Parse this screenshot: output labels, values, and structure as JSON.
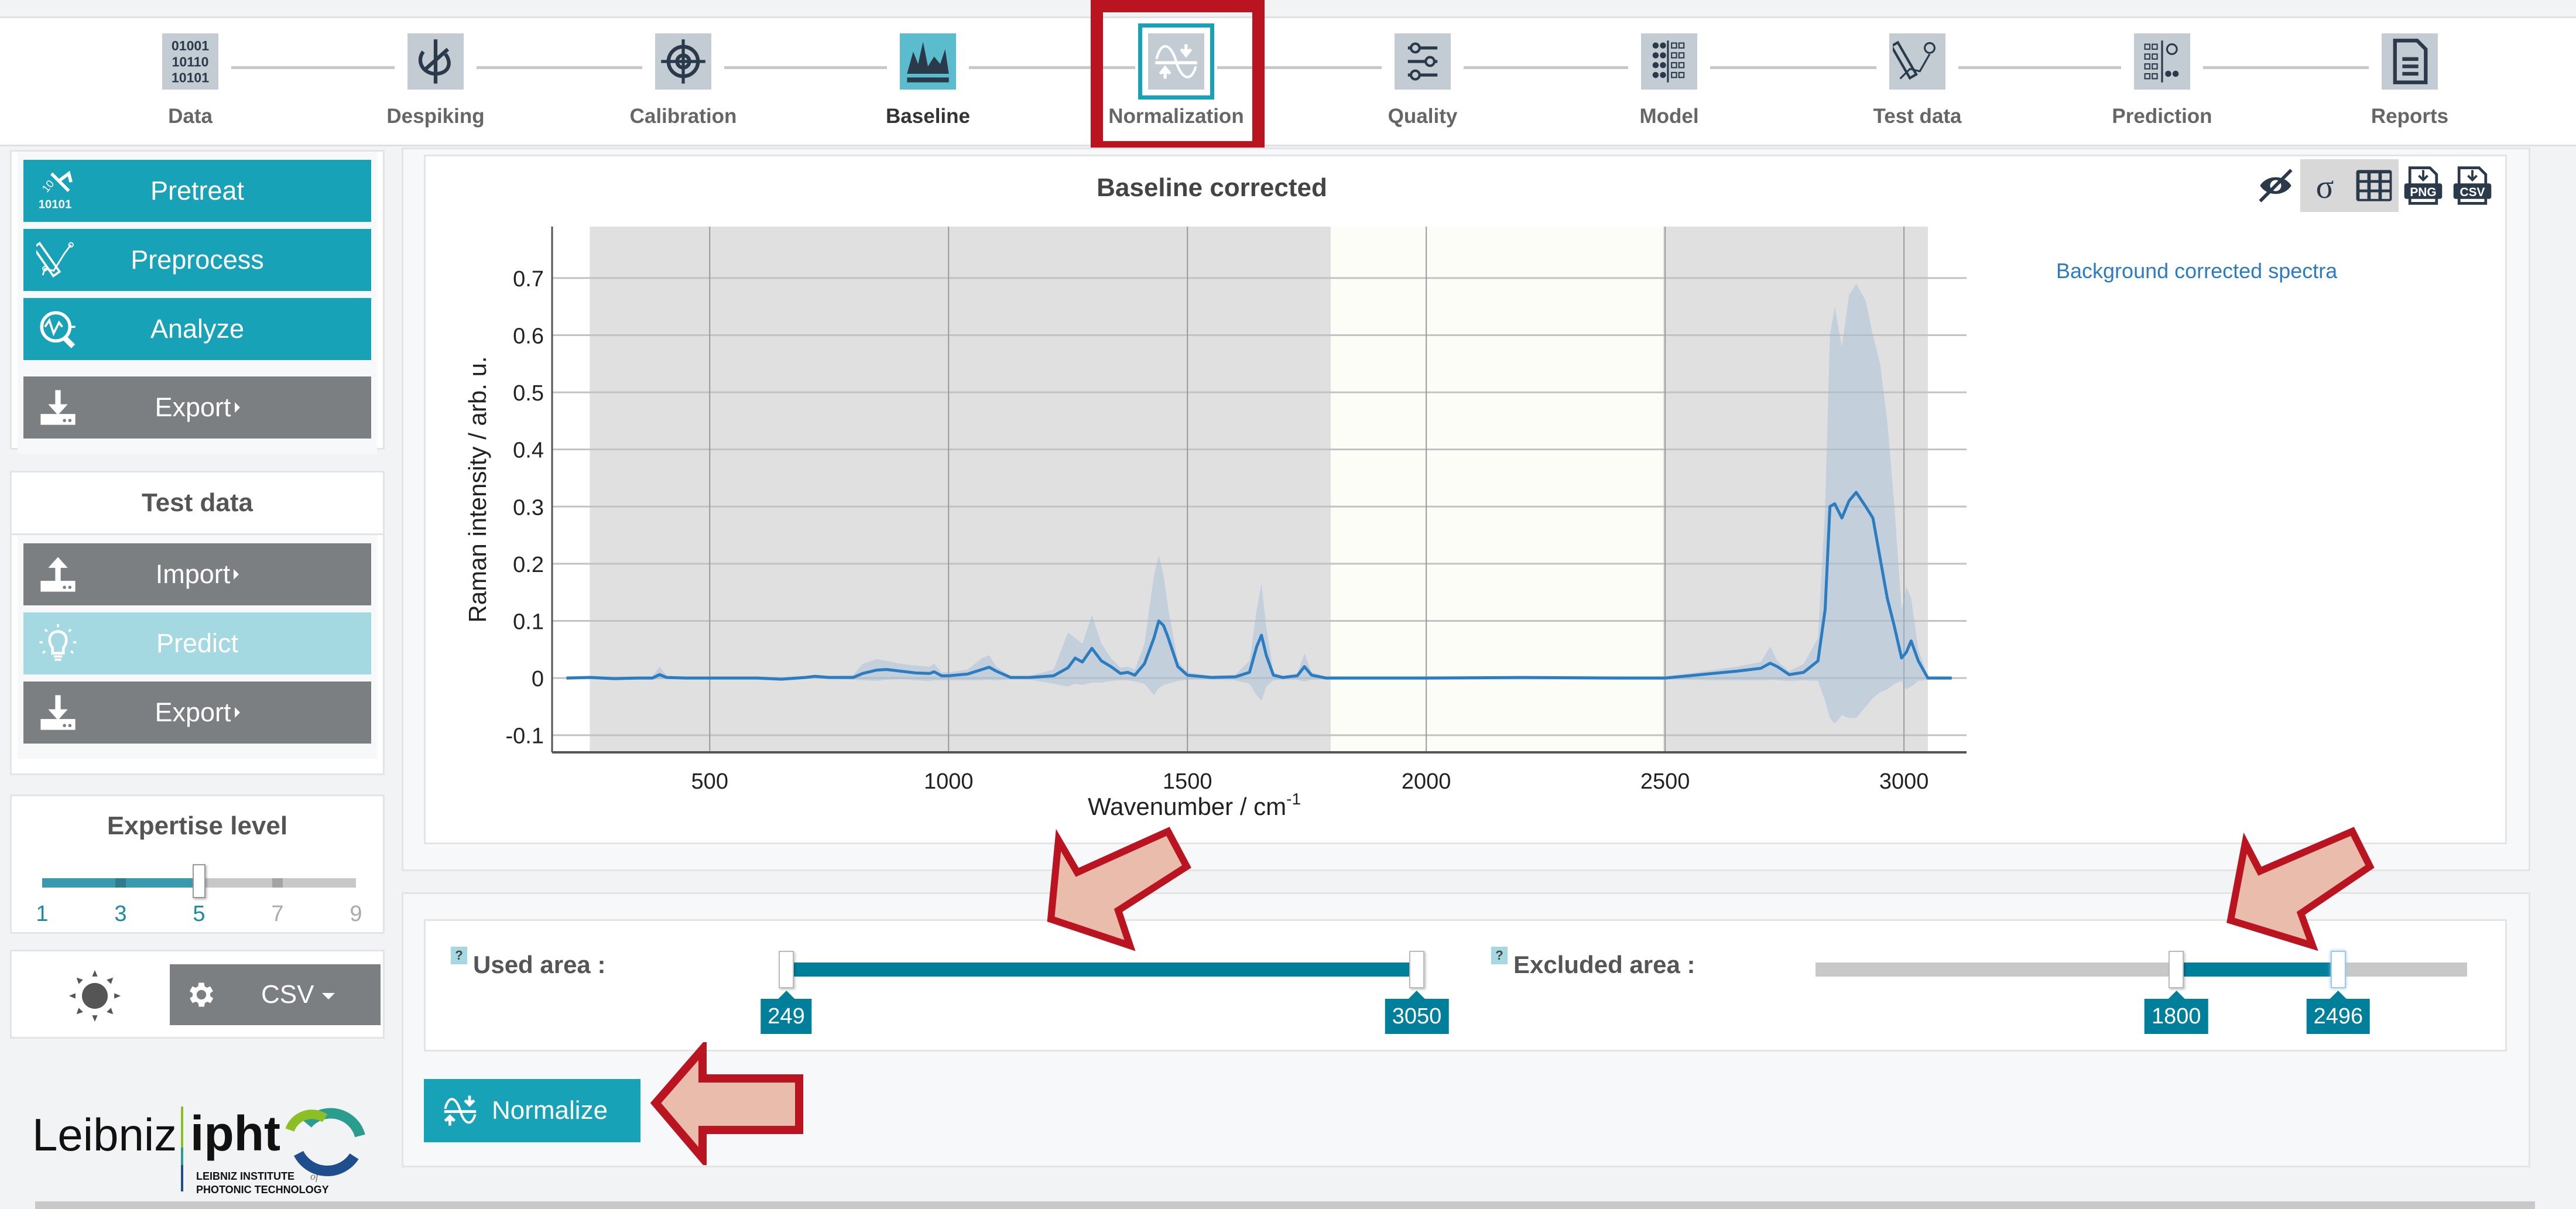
{
  "stepper": {
    "steps": [
      {
        "label": "Data",
        "icon": "binary-data-icon",
        "state": "default"
      },
      {
        "label": "Despiking",
        "icon": "despiking-icon",
        "state": "default"
      },
      {
        "label": "Calibration",
        "icon": "target-calibration-icon",
        "state": "default"
      },
      {
        "label": "Baseline",
        "icon": "baseline-icon",
        "state": "done"
      },
      {
        "label": "Normalization",
        "icon": "normalization-icon",
        "state": "current"
      },
      {
        "label": "Quality",
        "icon": "sliders-quality-icon",
        "state": "default"
      },
      {
        "label": "Model",
        "icon": "model-grid-icon",
        "state": "default"
      },
      {
        "label": "Test data",
        "icon": "test-data-icon",
        "state": "default"
      },
      {
        "label": "Prediction",
        "icon": "prediction-icon",
        "state": "default"
      },
      {
        "label": "Reports",
        "icon": "report-document-icon",
        "state": "default"
      }
    ]
  },
  "sidebar": {
    "training": {
      "buttons": [
        {
          "label": "Pretreat",
          "icon": "pretreat-icon",
          "style": "teal"
        },
        {
          "label": "Preprocess",
          "icon": "preprocess-icon",
          "style": "teal"
        },
        {
          "label": "Analyze",
          "icon": "analyze-icon",
          "style": "teal"
        },
        {
          "label": "Export",
          "icon": "download-icon",
          "style": "gray",
          "submenu": true
        }
      ]
    },
    "test_data": {
      "title": "Test data",
      "buttons": [
        {
          "label": "Import",
          "icon": "upload-icon",
          "style": "gray",
          "submenu": true
        },
        {
          "label": "Predict",
          "icon": "lightbulb-icon",
          "style": "light"
        },
        {
          "label": "Export",
          "icon": "download-icon",
          "style": "gray",
          "submenu": true
        }
      ]
    },
    "expertise": {
      "title": "Expertise level",
      "ticks": [
        "1",
        "3",
        "5",
        "7",
        "9"
      ],
      "min": 1,
      "max": 9,
      "value": 5,
      "active_color": "#1a8aa6",
      "inactive_color": "#aaaaaa"
    },
    "settings": {
      "theme_icon": "sun-icon",
      "format_label": "CSV"
    },
    "logo": {
      "left": "Leibniz",
      "right": "ipht",
      "sub1": "LEIBNIZ INSTITUTE",
      "sub_of": "of",
      "sub2": "PHOTONIC TECHNOLOGY"
    }
  },
  "chart_panel": {
    "tools": [
      {
        "name": "hide-icon",
        "active": false
      },
      {
        "name": "sigma-icon",
        "active": true
      },
      {
        "name": "grid-icon",
        "active": true
      },
      {
        "name": "download-png-icon",
        "active": false,
        "text": "PNG"
      },
      {
        "name": "download-csv-icon",
        "active": false,
        "text": "CSV"
      }
    ]
  },
  "chart_data": {
    "type": "line",
    "title": "Baseline corrected",
    "xlabel": "Wavenumber / cm",
    "xlabel_sup": "-1",
    "ylabel": "Raman intensity / arb. u.",
    "xlim": [
      170,
      3131
    ],
    "ylim": [
      -0.13,
      0.79
    ],
    "xticks": [
      500,
      1000,
      1500,
      2000,
      2500,
      3000
    ],
    "yticks": [
      -0.1,
      0,
      0.1,
      0.2,
      0.3,
      0.4,
      0.5,
      0.6,
      0.7
    ],
    "ytick_labels": [
      "-0.1",
      "0",
      "0.1",
      "0.2",
      "0.3",
      "0.4",
      "0.5",
      "0.6",
      "0.7"
    ],
    "grid": true,
    "legend": {
      "position": "right",
      "entries": [
        "Background corrected spectra"
      ]
    },
    "shaded_regions": [
      {
        "from": 249,
        "to": 1800,
        "kind": "used"
      },
      {
        "from": 1800,
        "to": 2496,
        "kind": "excluded"
      },
      {
        "from": 2496,
        "to": 3050,
        "kind": "used"
      }
    ],
    "series": [
      {
        "name": "Background corrected spectra",
        "color": "#2b7cc0",
        "x": [
          200,
          250,
          300,
          350,
          380,
          395,
          410,
          450,
          500,
          550,
          600,
          650,
          700,
          720,
          750,
          800,
          820,
          850,
          870,
          900,
          930,
          960,
          970,
          985,
          1000,
          1040,
          1070,
          1085,
          1100,
          1130,
          1170,
          1220,
          1250,
          1265,
          1280,
          1300,
          1320,
          1340,
          1360,
          1375,
          1390,
          1410,
          1430,
          1440,
          1450,
          1460,
          1480,
          1500,
          1550,
          1600,
          1630,
          1645,
          1655,
          1665,
          1680,
          1700,
          1730,
          1745,
          1760,
          1790,
          1850,
          2000,
          2200,
          2400,
          2500,
          2550,
          2600,
          2650,
          2700,
          2720,
          2735,
          2760,
          2790,
          2820,
          2835,
          2845,
          2855,
          2870,
          2885,
          2900,
          2920,
          2935,
          2950,
          2965,
          2980,
          2995,
          3005,
          3015,
          3030,
          3050,
          3080,
          3100
        ],
        "y": [
          0.0,
          0.001,
          -0.001,
          0.0,
          0.0,
          0.006,
          0.001,
          0.0,
          0.0,
          0.0,
          0.0,
          -0.002,
          0.001,
          0.003,
          0.001,
          0.001,
          0.008,
          0.014,
          0.015,
          0.012,
          0.009,
          0.008,
          0.011,
          0.004,
          0.004,
          0.007,
          0.015,
          0.019,
          0.012,
          0.001,
          0.001,
          0.004,
          0.018,
          0.035,
          0.028,
          0.052,
          0.03,
          0.02,
          0.008,
          0.01,
          0.005,
          0.025,
          0.07,
          0.1,
          0.092,
          0.07,
          0.02,
          0.005,
          0.001,
          0.002,
          0.01,
          0.055,
          0.075,
          0.04,
          0.005,
          0.001,
          0.004,
          0.02,
          0.005,
          0.0,
          0.0,
          0.0,
          0.001,
          0.0,
          0.0,
          0.004,
          0.008,
          0.012,
          0.017,
          0.026,
          0.02,
          0.006,
          0.01,
          0.03,
          0.12,
          0.3,
          0.305,
          0.28,
          0.31,
          0.325,
          0.3,
          0.28,
          0.21,
          0.14,
          0.09,
          0.035,
          0.045,
          0.065,
          0.03,
          0.0,
          0.0,
          0.0
        ],
        "band_upper": [
          0.003,
          0.004,
          0.003,
          0.003,
          0.003,
          0.02,
          0.004,
          0.003,
          0.003,
          0.003,
          0.003,
          0.002,
          0.004,
          0.006,
          0.004,
          0.005,
          0.025,
          0.033,
          0.03,
          0.025,
          0.022,
          0.02,
          0.025,
          0.01,
          0.01,
          0.015,
          0.035,
          0.04,
          0.02,
          0.004,
          0.004,
          0.015,
          0.08,
          0.07,
          0.06,
          0.11,
          0.06,
          0.035,
          0.018,
          0.02,
          0.015,
          0.06,
          0.18,
          0.215,
          0.18,
          0.12,
          0.03,
          0.01,
          0.004,
          0.006,
          0.03,
          0.12,
          0.165,
          0.09,
          0.01,
          0.004,
          0.008,
          0.043,
          0.01,
          0.003,
          0.003,
          0.003,
          0.003,
          0.003,
          0.003,
          0.008,
          0.014,
          0.02,
          0.028,
          0.055,
          0.03,
          0.012,
          0.025,
          0.07,
          0.3,
          0.6,
          0.65,
          0.58,
          0.67,
          0.69,
          0.66,
          0.6,
          0.55,
          0.45,
          0.3,
          0.12,
          0.16,
          0.14,
          0.05,
          0.003,
          0.003,
          0.003
        ],
        "band_lower": [
          -0.003,
          -0.002,
          -0.004,
          -0.003,
          -0.003,
          -0.002,
          -0.002,
          -0.003,
          -0.003,
          -0.003,
          -0.003,
          -0.005,
          -0.002,
          0.0,
          -0.002,
          -0.003,
          -0.004,
          -0.005,
          -0.003,
          -0.002,
          -0.004,
          -0.005,
          -0.004,
          -0.004,
          -0.004,
          -0.004,
          -0.004,
          -0.003,
          -0.004,
          -0.003,
          -0.003,
          -0.01,
          -0.015,
          -0.01,
          -0.012,
          -0.008,
          -0.008,
          -0.005,
          -0.004,
          -0.004,
          -0.006,
          -0.01,
          -0.03,
          -0.018,
          -0.012,
          -0.01,
          -0.005,
          -0.003,
          -0.003,
          -0.004,
          -0.01,
          -0.03,
          -0.04,
          -0.015,
          -0.004,
          -0.003,
          -0.003,
          -0.006,
          -0.003,
          -0.003,
          -0.003,
          -0.003,
          -0.003,
          -0.003,
          -0.003,
          -0.003,
          -0.004,
          -0.004,
          -0.004,
          -0.003,
          -0.004,
          -0.005,
          -0.004,
          -0.005,
          -0.04,
          -0.07,
          -0.08,
          -0.065,
          -0.07,
          -0.07,
          -0.05,
          -0.035,
          -0.025,
          -0.02,
          -0.01,
          -0.005,
          -0.02,
          -0.015,
          -0.005,
          -0.003,
          -0.003,
          -0.003
        ]
      }
    ]
  },
  "range_controls": {
    "used_area": {
      "label": "Used area :",
      "help": "?",
      "min": 249,
      "max": 3050,
      "low": 249,
      "high": 3050
    },
    "excluded_area": {
      "label": "Excluded area :",
      "help": "?",
      "min": 249,
      "max": 3050,
      "low": 1800,
      "high": 2496
    }
  },
  "normalize_button": {
    "label": "Normalize",
    "icon": "normalize-icon"
  },
  "colors": {
    "accent": "#18a2b8",
    "slider_fill": "#007f9b",
    "gray_button": "#7b7f82",
    "annotation_red": "#b9141f",
    "annotation_fill": "#eabcab"
  }
}
